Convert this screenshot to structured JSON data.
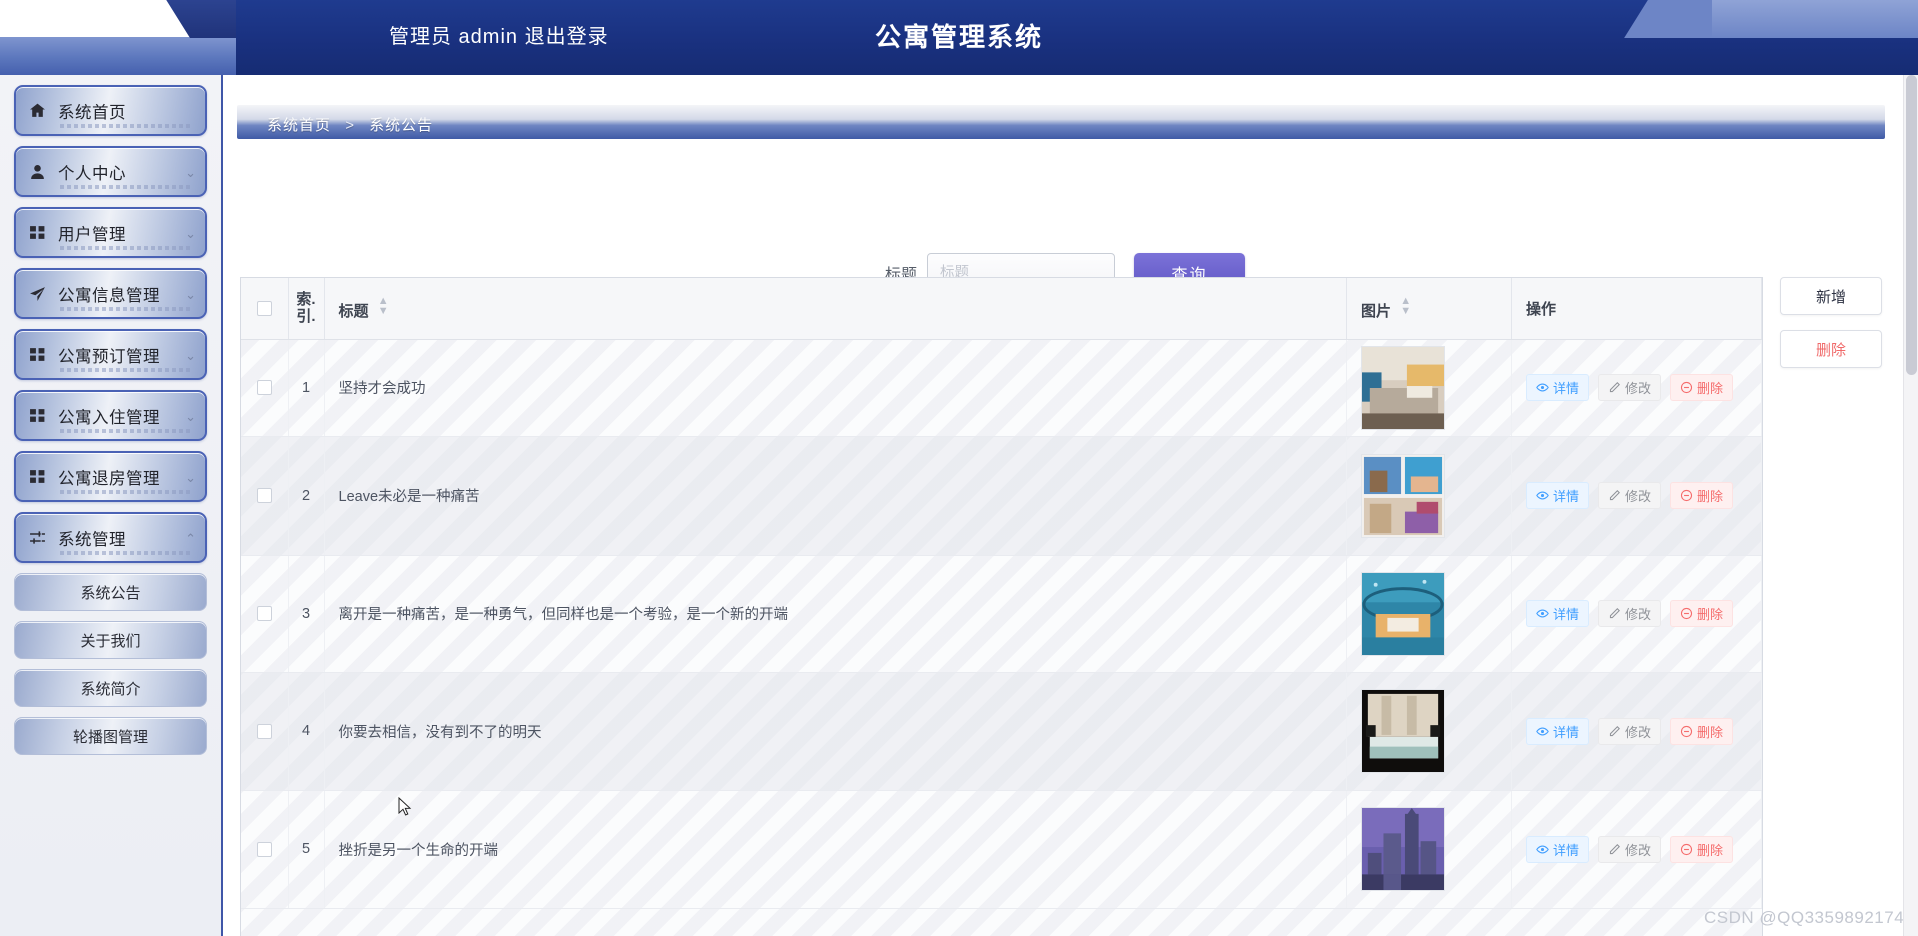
{
  "header": {
    "user_text": "管理员 admin  退出登录",
    "title": "公寓管理系统"
  },
  "sidebar": {
    "items": [
      {
        "label": "系统首页",
        "icon": "home-icon",
        "caret": ""
      },
      {
        "label": "个人中心",
        "icon": "user-icon",
        "caret": "⌄"
      },
      {
        "label": "用户管理",
        "icon": "grid-icon",
        "caret": "⌄"
      },
      {
        "label": "公寓信息管理",
        "icon": "send-icon",
        "caret": "⌄"
      },
      {
        "label": "公寓预订管理",
        "icon": "grid-icon",
        "caret": "⌄"
      },
      {
        "label": "公寓入住管理",
        "icon": "grid-icon",
        "caret": "⌄"
      },
      {
        "label": "公寓退房管理",
        "icon": "grid-icon",
        "caret": "⌄"
      },
      {
        "label": "系统管理",
        "icon": "sliders-icon",
        "caret": "⌃"
      }
    ],
    "subitems": [
      {
        "label": "系统公告"
      },
      {
        "label": "关于我们"
      },
      {
        "label": "系统简介"
      },
      {
        "label": "轮播图管理"
      }
    ]
  },
  "breadcrumb": {
    "root": "系统首页",
    "separator": ">",
    "current": "系统公告"
  },
  "search": {
    "label": "标题",
    "value": "",
    "placeholder": "标题",
    "button_label": "查询"
  },
  "table": {
    "headers": {
      "select_all": "",
      "index": "索\n引",
      "index_l1": "索.",
      "index_l2": "引.",
      "title": "标题",
      "image": "图片",
      "action": "操作"
    },
    "rows": [
      {
        "index": "1",
        "title": "坚持才会成功",
        "image": "hotel-bedroom-warm-lighting"
      },
      {
        "index": "2",
        "title": "Leave未必是一种痛苦",
        "image": "suite-photo-collage"
      },
      {
        "index": "3",
        "title": "离开是一种痛苦，是一种勇气，但同样也是一个考验，是一个新的开端",
        "image": "underwater-suite"
      },
      {
        "index": "4",
        "title": "你要去相信，没有到不了的明天",
        "image": "twin-bed-hotel-room"
      },
      {
        "index": "5",
        "title": "挫折是另一个生命的开端",
        "image": "city-skyline-night"
      }
    ],
    "row_actions": [
      {
        "label": "详情",
        "icon": "eye-icon",
        "kind": "detail"
      },
      {
        "label": "修改",
        "icon": "pencil-icon",
        "kind": "edit"
      },
      {
        "label": "删除",
        "icon": "minus-circle-icon",
        "kind": "delete"
      }
    ]
  },
  "side_actions": {
    "add_label": "新增",
    "delete_label": "删除"
  },
  "watermark": "CSDN @QQ3359892174",
  "colors": {
    "header_blue": "#1f3b8f",
    "accent_purple": "#6f65ce",
    "detail_blue": "#409eff",
    "delete_red": "#f56c6c",
    "sidebar_border": "#3f56a8"
  }
}
